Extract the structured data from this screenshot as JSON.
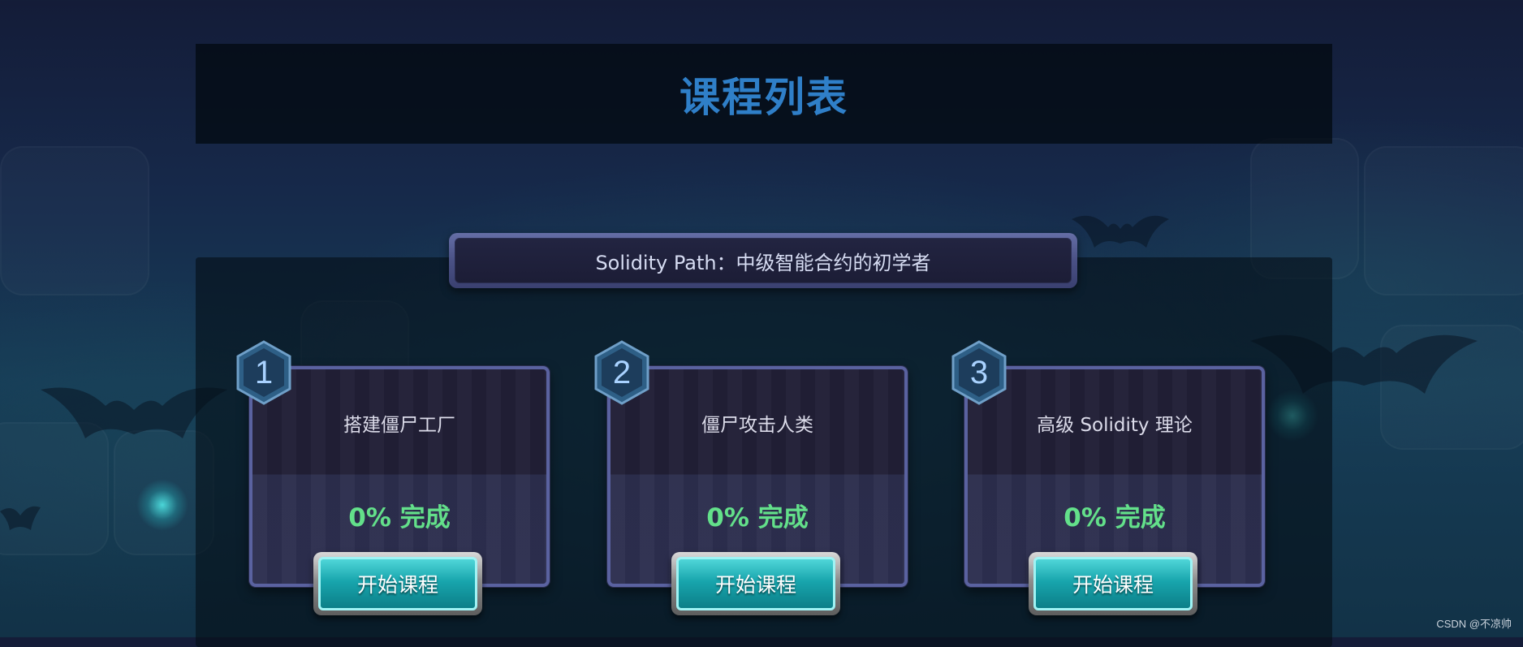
{
  "header": {
    "title": "课程列表"
  },
  "path_banner": {
    "text": "Solidity Path：中级智能合约的初学者"
  },
  "courses": [
    {
      "number": "1",
      "title": "搭建僵尸工厂",
      "progress": "0% 完成",
      "button": "开始课程"
    },
    {
      "number": "2",
      "title": "僵尸攻击人类",
      "progress": "0% 完成",
      "button": "开始课程"
    },
    {
      "number": "3",
      "title": "高级 Solidity 理论",
      "progress": "0% 完成",
      "button": "开始课程"
    }
  ],
  "watermark": "CSDN @不凉帅",
  "colors": {
    "title": "#2f7fc8",
    "progress": "#63e08a",
    "button": "#18a5ad",
    "card_border": "#5a62a0"
  }
}
